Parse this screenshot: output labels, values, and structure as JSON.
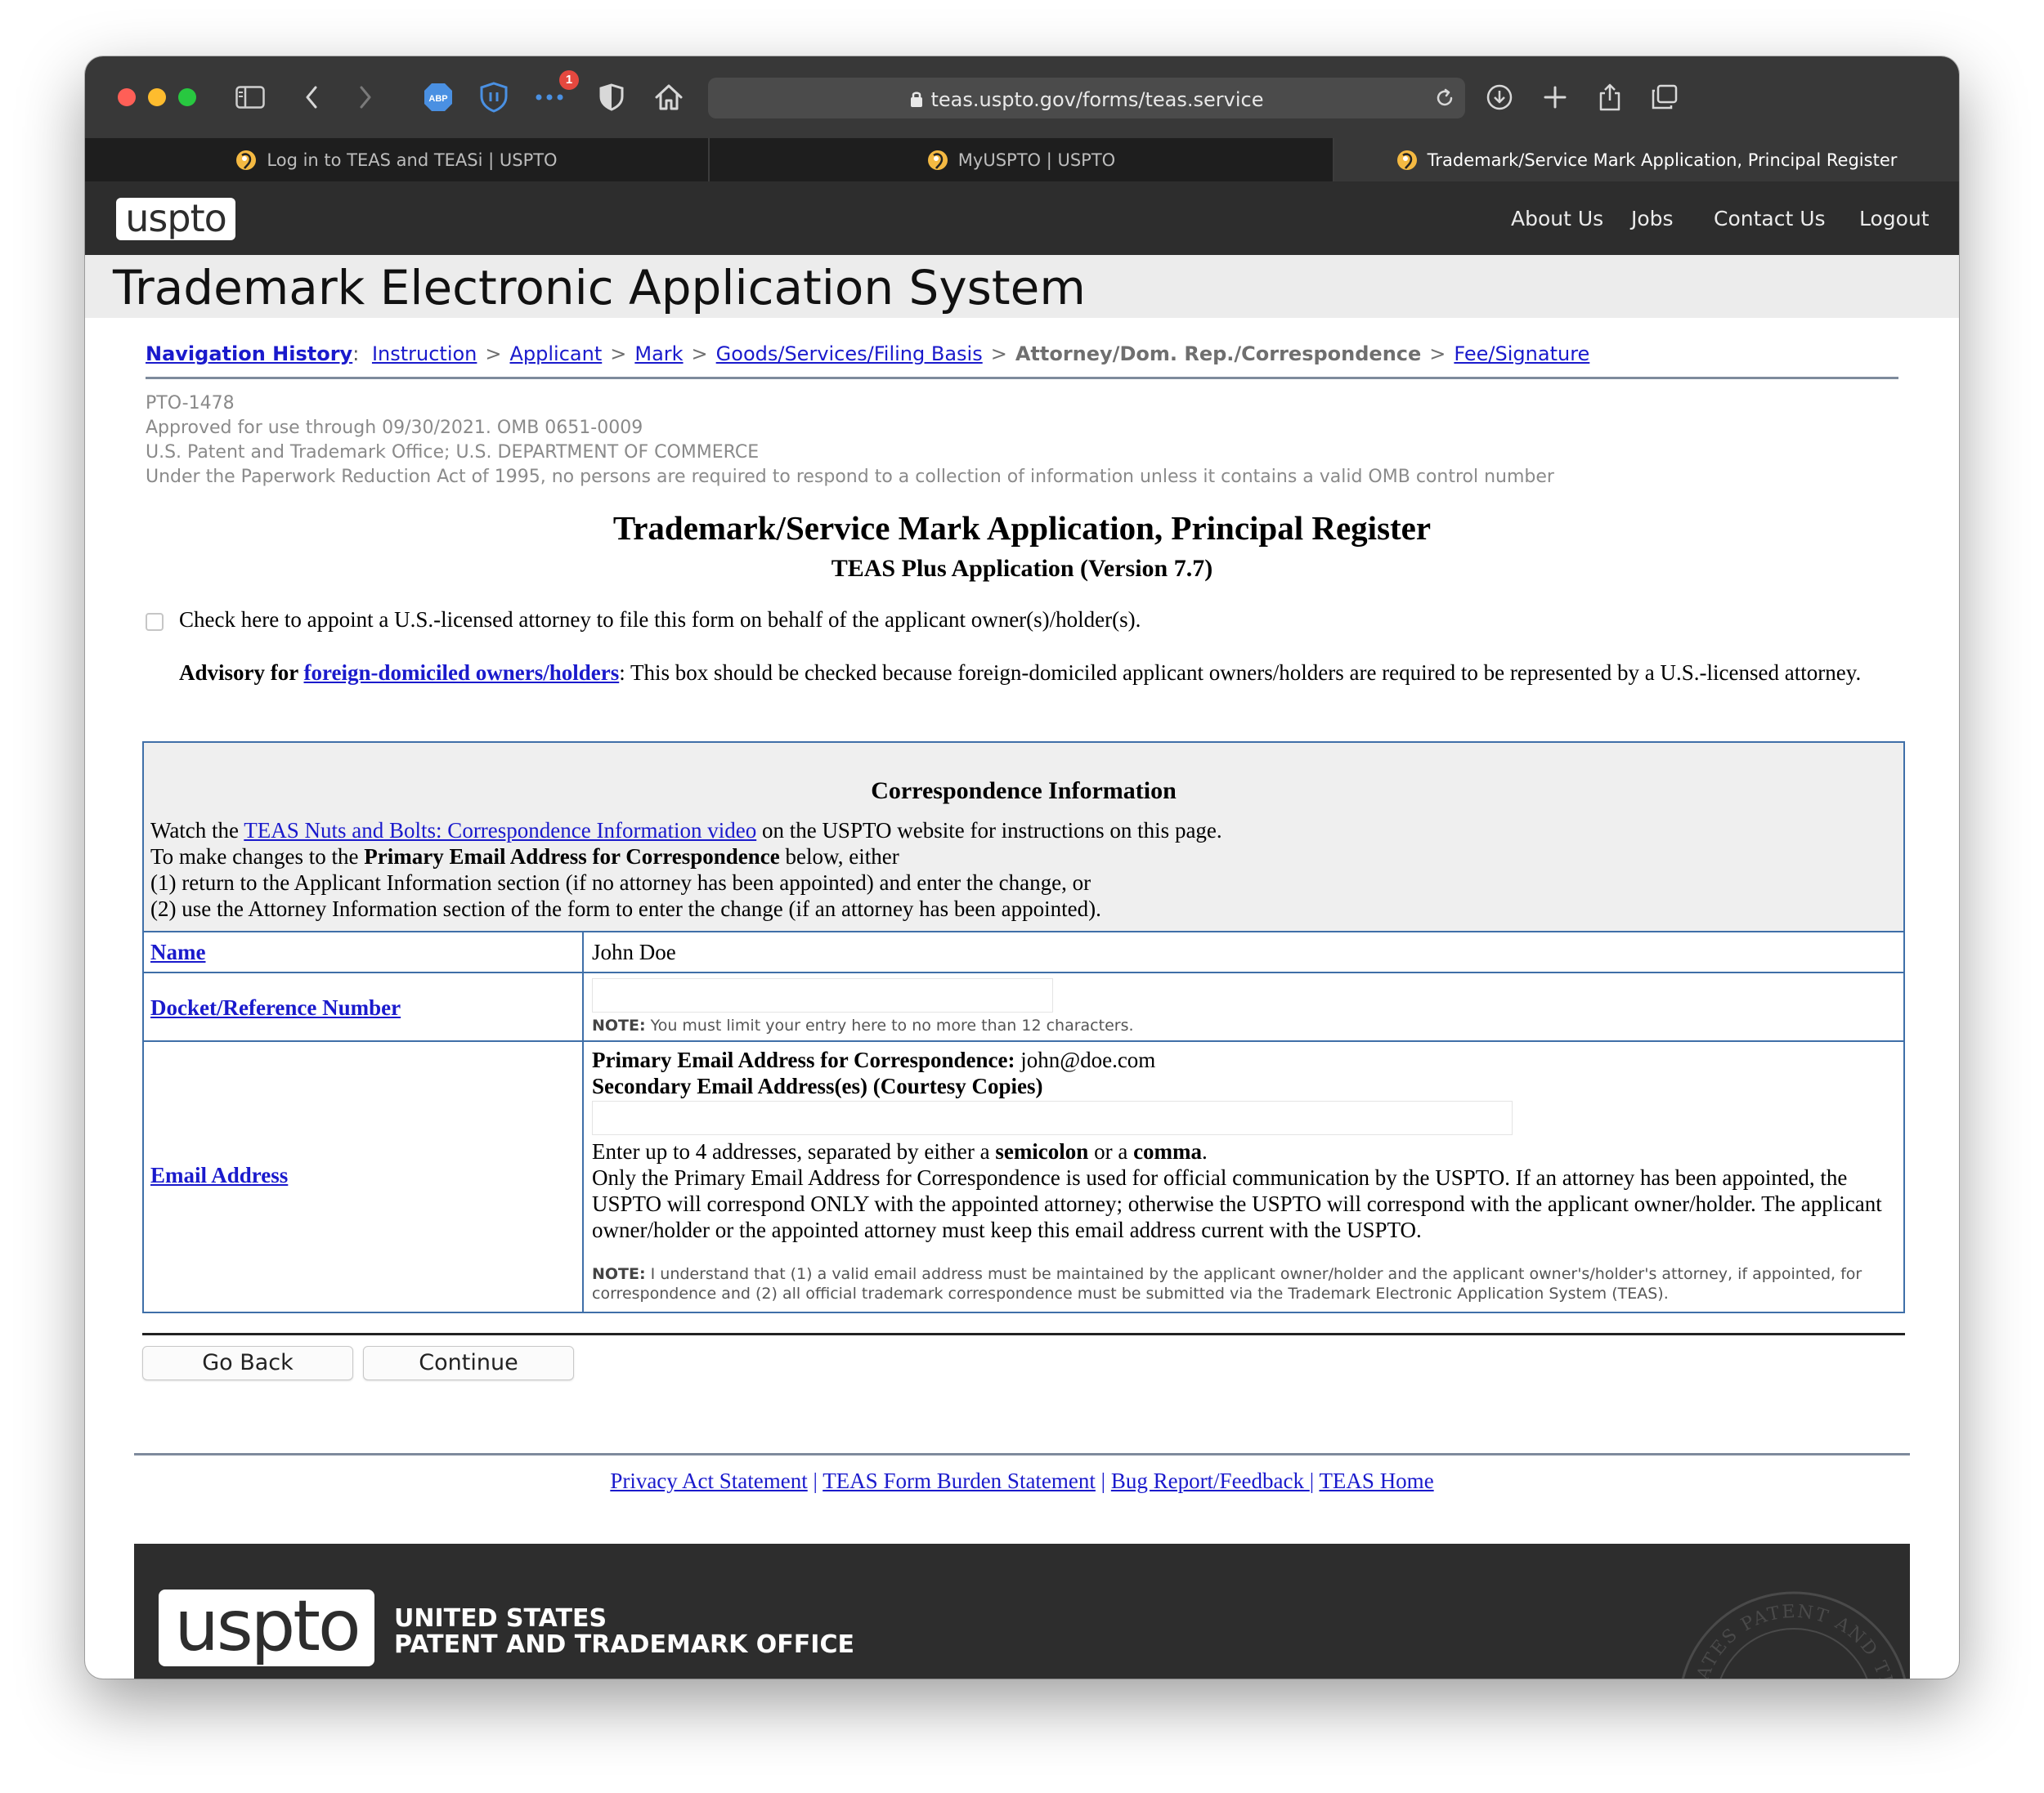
{
  "browser": {
    "url": "teas.uspto.gov/forms/teas.service",
    "extension_badge_count": "1",
    "tabs": [
      {
        "label": "Log in to TEAS and TEASi | USPTO",
        "active": false
      },
      {
        "label": "MyUSPTO | USPTO",
        "active": false
      },
      {
        "label": "Trademark/Service Mark Application, Principal Register",
        "active": true
      }
    ]
  },
  "header": {
    "logo": "uspto",
    "nav": [
      "About Us",
      "Jobs",
      "Contact Us",
      "Logout"
    ],
    "app_title": "Trademark Electronic Application System"
  },
  "breadcrumb": {
    "label": "Navigation History",
    "colon": ":",
    "items": [
      "Instruction",
      "Applicant",
      "Mark",
      "Goods/Services/Filing Basis",
      "Attorney/Dom. Rep./Correspondence",
      "Fee/Signature"
    ],
    "separator": ">"
  },
  "omb": {
    "form_number": "PTO-1478",
    "approved": "Approved for use through 09/30/2021. OMB 0651-0009",
    "office": "U.S. Patent and Trademark Office; U.S. DEPARTMENT OF COMMERCE",
    "paperwork": "Under the Paperwork Reduction Act of 1995, no persons are required to respond to a collection of information unless it contains a valid OMB control number"
  },
  "form": {
    "title": "Trademark/Service Mark Application, Principal Register",
    "subtitle": "TEAS Plus Application (Version 7.7)",
    "attorney_checkbox_label": "Check here to appoint a U.S.-licensed attorney to file this form on behalf of the applicant owner(s)/holder(s).",
    "attorney_checked": false,
    "advisory": {
      "prefix": "Advisory for ",
      "link": "foreign-domiciled owners/holders",
      "text": ": This box should be checked because foreign-domiciled applicant owners/holders are required to be represented by a U.S.-licensed attorney."
    }
  },
  "correspondence": {
    "title": "Correspondence Information",
    "watch_prefix": "Watch the ",
    "watch_link": "TEAS Nuts and Bolts: Correspondence Information video",
    "watch_suffix": " on the USPTO website for instructions on this page.",
    "changes_prefix": "To make changes to the ",
    "changes_bold": "Primary Email Address for Correspondence",
    "changes_suffix": " below, either",
    "option1": "(1) return to the Applicant Information section (if no attorney has been appointed) and enter the change, or",
    "option2": "(2) use the Attorney Information section of the form to enter the change (if an attorney has been appointed).",
    "name_label": "Name",
    "name_value": "John Doe",
    "docket_label": "Docket/Reference Number",
    "docket_value": "",
    "docket_note_label": "NOTE:",
    "docket_note": " You must limit your entry here to no more than 12 characters.",
    "email_label": "Email Address",
    "primary_email_label": "Primary Email Address for Correspondence:",
    "primary_email": " john@doe.com",
    "secondary_label": "Secondary Email Address(es) (Courtesy Copies)",
    "secondary_value": "",
    "enter_prefix": "Enter up to 4 addresses, separated by either a ",
    "enter_semicolon": "semicolon",
    "enter_or": " or a ",
    "enter_comma": "comma",
    "enter_end": ".",
    "official_text": "Only the Primary Email Address for Correspondence is used for official communication by the USPTO. If an attorney has been appointed, the USPTO will correspond ONLY with the appointed attorney; otherwise the USPTO will correspond with the applicant owner/holder. The applicant owner/holder or the appointed attorney must keep this email address current with the USPTO.",
    "email_note_label": "NOTE:",
    "email_note": " I understand that (1) a valid email address must be maintained by the applicant owner/holder and the applicant owner's/holder's attorney, if appointed, for correspondence and (2) all official trademark correspondence must be submitted via the Trademark Electronic Application System (TEAS)."
  },
  "buttons": {
    "back": "Go Back",
    "continue": "Continue"
  },
  "footer": {
    "links": [
      "Privacy Act Statement",
      "TEAS Form Burden Statement",
      "Bug Report/Feedback ",
      "TEAS Home"
    ],
    "divider": " | ",
    "logo": "uspto",
    "org_line1": "UNITED STATES",
    "org_line2": "PATENT AND TRADEMARK OFFICE",
    "seal_text": "STATES PATENT AND TRADEMARK O"
  },
  "colors": {
    "link": "#1a1acc",
    "table_border": "#3f6fa8",
    "header_bg": "#2d2d2d"
  }
}
